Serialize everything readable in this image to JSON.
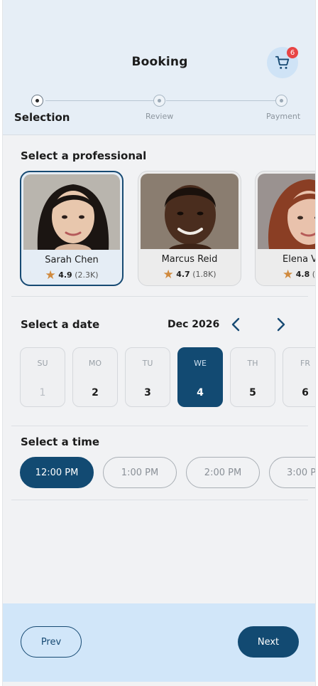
{
  "header": {
    "title": "Booking",
    "cart": {
      "icon": "cart-icon",
      "badge_count": "6"
    }
  },
  "stepper": {
    "steps": [
      {
        "label": "Selection",
        "active": true
      },
      {
        "label": "Review",
        "active": false
      },
      {
        "label": "Payment",
        "active": false
      }
    ]
  },
  "professionals": {
    "section_title": "Select a professional",
    "items": [
      {
        "name": "Sarah Chen",
        "rating": "4.9",
        "reviews": "(2.3K)",
        "selected": true
      },
      {
        "name": "Marcus Reid",
        "rating": "4.7",
        "reviews": "(1.8K)",
        "selected": false
      },
      {
        "name": "Elena Vo",
        "rating": "4.8",
        "reviews": "(9",
        "selected": false
      }
    ]
  },
  "date": {
    "section_title": "Select a date",
    "month": "Dec 2026",
    "prev_icon": "chevron-left-icon",
    "next_icon": "chevron-right-icon",
    "days": [
      {
        "name": "SU",
        "number": "1",
        "state": "disabled"
      },
      {
        "name": "MO",
        "number": "2",
        "state": "normal"
      },
      {
        "name": "TU",
        "number": "3",
        "state": "normal"
      },
      {
        "name": "WE",
        "number": "4",
        "state": "selected"
      },
      {
        "name": "TH",
        "number": "5",
        "state": "normal"
      },
      {
        "name": "FR",
        "number": "6",
        "state": "normal"
      }
    ]
  },
  "time": {
    "section_title": "Select a time",
    "slots": [
      {
        "label": "12:00 PM",
        "selected": true
      },
      {
        "label": "1:00 PM",
        "selected": false
      },
      {
        "label": "2:00 PM",
        "selected": false
      },
      {
        "label": "3:00 P",
        "selected": false
      }
    ]
  },
  "footer": {
    "prev_label": "Prev",
    "next_label": "Next"
  },
  "colors": {
    "primary": "#124a72",
    "header_bg": "#e6eef6",
    "footer_bg": "#d1e6f9",
    "badge": "#e84545",
    "star": "#d08a3e"
  }
}
